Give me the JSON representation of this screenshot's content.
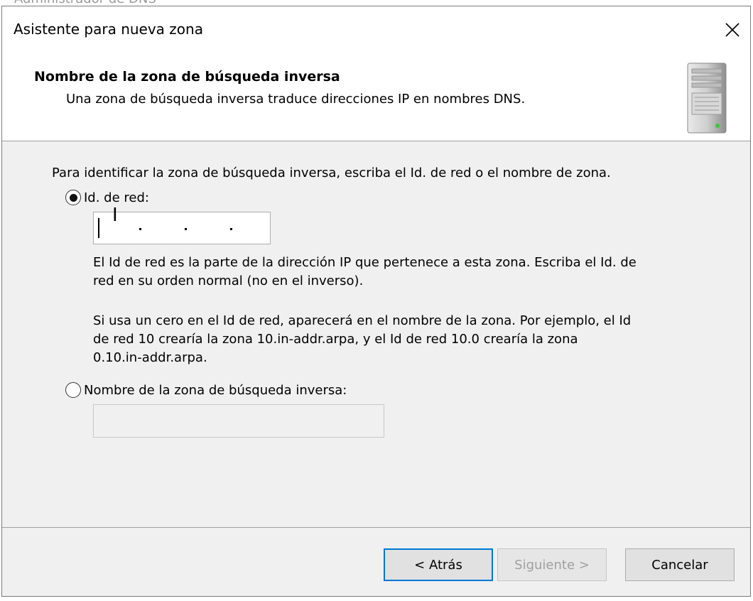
{
  "background_window": {
    "title": "Administrador de DNS"
  },
  "dialog": {
    "title": "Asistente para nueva zona",
    "close_symbol": "✕"
  },
  "header": {
    "title": "Nombre de la zona de búsqueda inversa",
    "subtitle": "Una zona de búsqueda inversa traduce direcciones IP en nombres DNS.",
    "icon": "server-tower-icon"
  },
  "content": {
    "intro": "Para identificar la zona de búsqueda inversa, escriba el Id. de red o el nombre de zona.",
    "option_network_id": {
      "label": "Id. de red:",
      "selected": true
    },
    "network_id_value": "",
    "help_1_line1": "El Id de red es la parte de la dirección IP que pertenece a esta zona. Escriba el Id. de",
    "help_1_line2": "red en su orden normal (no en el inverso).",
    "help_2_line1": "Si usa un cero en el Id de red, aparecerá en el nombre de la zona.  Por ejemplo, el Id",
    "help_2_line2": "de red 10 crearía la zona 10.in-addr.arpa, y el Id de red 10.0 crearía la zona",
    "help_2_line3": "0.10.in-addr.arpa.",
    "option_zone_name": {
      "label": "Nombre de la zona de búsqueda inversa:",
      "selected": false
    },
    "zone_name_value": ""
  },
  "buttons": {
    "back": "< Atrás",
    "next": "Siguiente >",
    "cancel": "Cancelar"
  },
  "colors": {
    "dialog_bg": "#f0f0f0",
    "accent": "#0078d7"
  }
}
